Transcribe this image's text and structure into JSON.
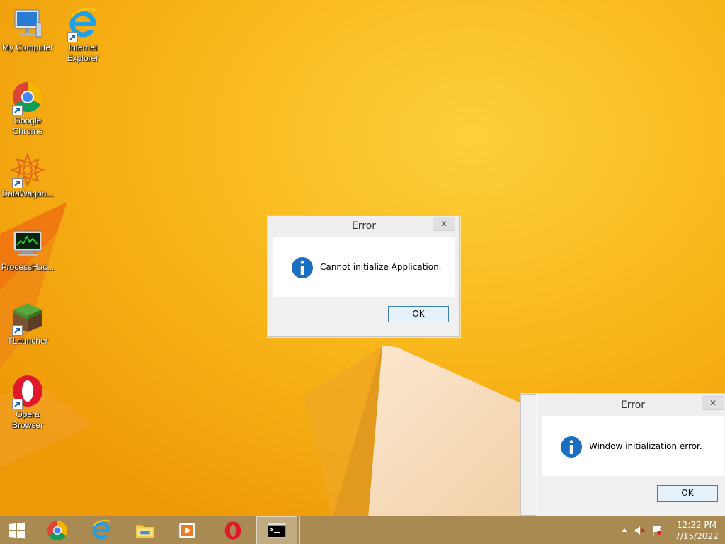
{
  "desktop_icons": [
    {
      "label": "My Computer",
      "icon": "computer-icon"
    },
    {
      "label": "Internet Explorer",
      "line1": "Internet",
      "line2": "Explorer",
      "icon": "internet-explorer-icon"
    },
    {
      "label": "Google Chrome",
      "line1": "Google",
      "line2": "Chrome",
      "icon": "chrome-icon"
    },
    {
      "label": "DataWagon...",
      "icon": "datawagon-icon"
    },
    {
      "label": "ProcessHac...",
      "icon": "process-hacker-icon"
    },
    {
      "label": "TLauncher",
      "icon": "tlauncher-icon"
    },
    {
      "label": "Opera Browser",
      "line1": "Opera",
      "line2": "Browser",
      "icon": "opera-icon"
    }
  ],
  "dialogs": [
    {
      "title": "Error",
      "close_label": "✕",
      "message": "Cannot initialize Application.",
      "ok_label": "OK"
    },
    {
      "title": "Error",
      "close_label": "✕",
      "message": "Window initialization error.",
      "ok_label": "OK"
    }
  ],
  "taskbar": {
    "items": [
      "start-icon",
      "chrome-icon",
      "internet-explorer-icon",
      "file-explorer-icon",
      "media-player-icon",
      "opera-icon",
      "command-prompt-icon"
    ],
    "active_item": "command-prompt-icon",
    "tray": [
      "show-hidden-icons-chevron",
      "speaker-muted-icon",
      "action-center-flag-icon"
    ],
    "clock_time": "12:22 PM",
    "clock_date": "7/15/2022"
  },
  "colors": {
    "wallpaper": "#f7ae14",
    "taskbar": "#a88a52",
    "info_blue": "#1c6fc0"
  }
}
